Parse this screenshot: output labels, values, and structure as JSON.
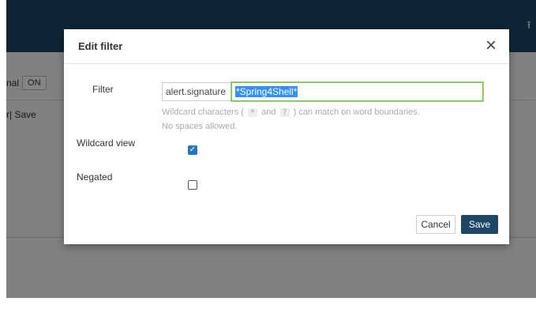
{
  "background": {
    "row1_label": "nal",
    "row1_toggle": "ON",
    "row2_text": "r|  Save"
  },
  "modal": {
    "title": "Edit filter",
    "close_glyph": "×",
    "filter_label": "Filter",
    "filter_field_name": "alert.signature",
    "filter_value": "*Spring4Shell*",
    "hint_before": "Wildcard characters (",
    "hint_star": "*",
    "hint_and": "and",
    "hint_q": "?",
    "hint_after": ") can match on word boundaries.",
    "hint_line2": "No spaces allowed.",
    "wildcard_label": "Wildcard view",
    "wildcard_checked": true,
    "negated_label": "Negated",
    "negated_checked": false,
    "cancel_label": "Cancel",
    "save_label": "Save"
  },
  "icons": {
    "upload": "upload-icon",
    "close": "close-icon",
    "check": "checkmark-icon"
  },
  "colors": {
    "header": "#1e4766",
    "primary_button": "#1e4766",
    "checkbox": "#2176c8",
    "input_focus_border": "#7dbf55",
    "selection": "#3390ff"
  }
}
